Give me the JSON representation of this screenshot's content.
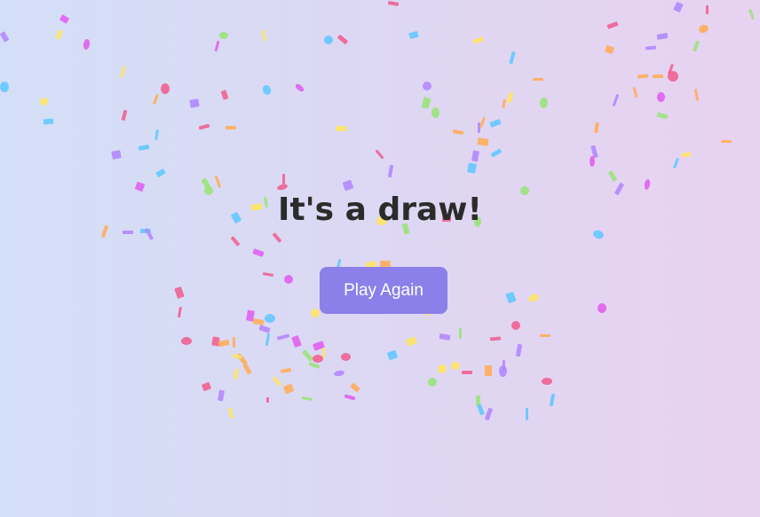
{
  "result": {
    "title": "It's a draw!"
  },
  "actions": {
    "play_again_label": "Play Again"
  },
  "colors": {
    "button": "#8b80e9",
    "title_text": "#2b2b2b",
    "background_left": "#d3dff7",
    "background_right": "#e8d2f1",
    "confetti": [
      "#f06292",
      "#b388ff",
      "#64c8ff",
      "#9be37a",
      "#ffe566",
      "#ffad5a",
      "#e060f0",
      "#7d8cff"
    ]
  },
  "decoration": {
    "confetti": "confetti-celebration"
  }
}
